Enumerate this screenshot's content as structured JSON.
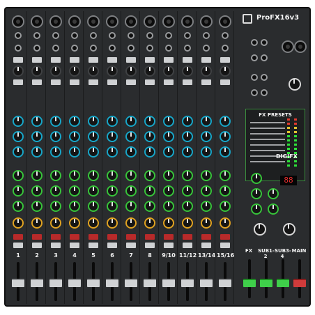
{
  "brand": "ProFX16v3",
  "fx_presets_label": "FX PRESETS",
  "digifx_label": "DIGIFX",
  "fx_display_value": "88",
  "channel_labels": [
    "1",
    "2",
    "3",
    "4",
    "5",
    "6",
    "7",
    "8",
    "9/10",
    "11/12",
    "13/14",
    "15/16"
  ],
  "bus_labels": [
    "FX",
    "SUB1-2",
    "SUB3-4",
    "MAIN"
  ],
  "colors": {
    "body": "#2a2c2e",
    "eq_knob": "#17a6c8",
    "aux_knob": "#37c43a",
    "pan_knob": "#e0a221",
    "mute_button": "#b82a2a",
    "accent_green": "#3fcf4a"
  }
}
